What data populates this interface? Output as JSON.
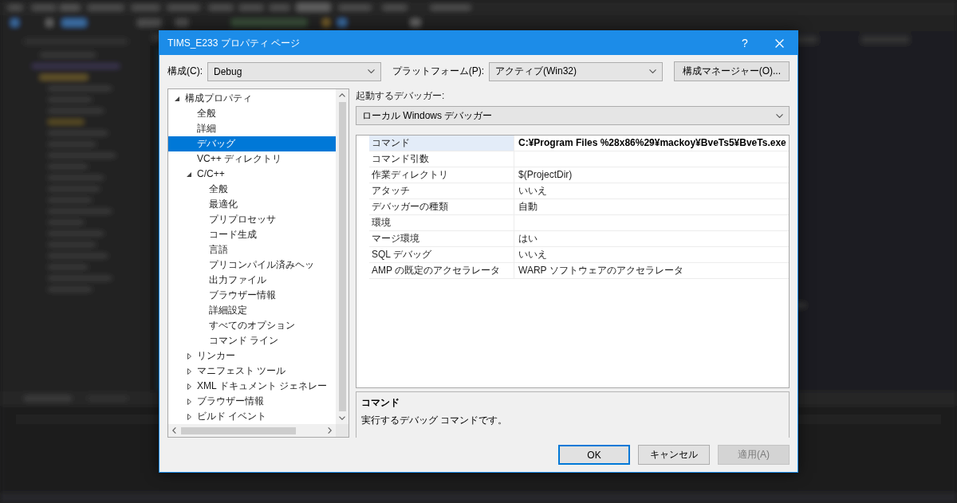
{
  "window": {
    "title": "TIMS_E233 プロパティ ページ",
    "help_button": "?"
  },
  "configuration": {
    "label": "構成(C):",
    "value": "Debug"
  },
  "platform": {
    "label": "プラットフォーム(P):",
    "value": "アクティブ(Win32)"
  },
  "configuration_manager_button": "構成マネージャー(O)...",
  "tree": [
    {
      "label": "構成プロパティ",
      "selected": false,
      "expanded": true,
      "children": [
        {
          "label": "全般",
          "selected": false
        },
        {
          "label": "詳細",
          "selected": false
        },
        {
          "label": "デバッグ",
          "selected": true
        },
        {
          "label": "VC++ ディレクトリ",
          "selected": false
        },
        {
          "label": "C/C++",
          "selected": false,
          "expanded": true,
          "children": [
            {
              "label": "全般",
              "selected": false
            },
            {
              "label": "最適化",
              "selected": false
            },
            {
              "label": "プリプロセッサ",
              "selected": false
            },
            {
              "label": "コード生成",
              "selected": false
            },
            {
              "label": "言語",
              "selected": false
            },
            {
              "label": "プリコンパイル済みヘッ",
              "selected": false
            },
            {
              "label": "出力ファイル",
              "selected": false
            },
            {
              "label": "ブラウザー情報",
              "selected": false
            },
            {
              "label": "詳細設定",
              "selected": false
            },
            {
              "label": "すべてのオプション",
              "selected": false
            },
            {
              "label": "コマンド ライン",
              "selected": false
            }
          ]
        },
        {
          "label": "リンカー",
          "selected": false,
          "expanded": false
        },
        {
          "label": "マニフェスト ツール",
          "selected": false,
          "expanded": false
        },
        {
          "label": "XML ドキュメント ジェネレー",
          "selected": false,
          "expanded": false
        },
        {
          "label": "ブラウザー情報",
          "selected": false,
          "expanded": false
        },
        {
          "label": "ビルド イベント",
          "selected": false,
          "expanded": false
        }
      ]
    }
  ],
  "debugger": {
    "label": "起動するデバッガー:",
    "value": "ローカル Windows デバッガー"
  },
  "properties": [
    {
      "name": "コマンド",
      "value": "C:¥Program Files %28x86%29¥mackoy¥BveTs5¥BveTs.exe",
      "selected": true,
      "modified": true
    },
    {
      "name": "コマンド引数",
      "selected": false
    },
    {
      "name": "作業ディレクトリ",
      "value": "$(ProjectDir)",
      "selected": false,
      "modified": false
    },
    {
      "name": "アタッチ",
      "value": "いいえ",
      "selected": false,
      "modified": false
    },
    {
      "name": "デバッガーの種類",
      "value": "自動",
      "selected": false,
      "modified": false
    },
    {
      "name": "環境",
      "selected": false
    },
    {
      "name": "マージ環境",
      "value": "はい",
      "selected": false,
      "modified": false
    },
    {
      "name": "SQL デバッグ",
      "value": "いいえ",
      "selected": false,
      "modified": false
    },
    {
      "name": "AMP の既定のアクセラレータ",
      "value": "WARP ソフトウェアのアクセラレータ",
      "selected": false,
      "modified": false
    }
  ],
  "description": {
    "title": "コマンド",
    "text": "実行するデバッグ コマンドです。"
  },
  "buttons": [
    {
      "label": "OK",
      "default": true,
      "disabled": false
    },
    {
      "label": "キャンセル",
      "default": false,
      "disabled": false
    },
    {
      "label": "適用(A)",
      "default": false,
      "disabled": true
    }
  ]
}
